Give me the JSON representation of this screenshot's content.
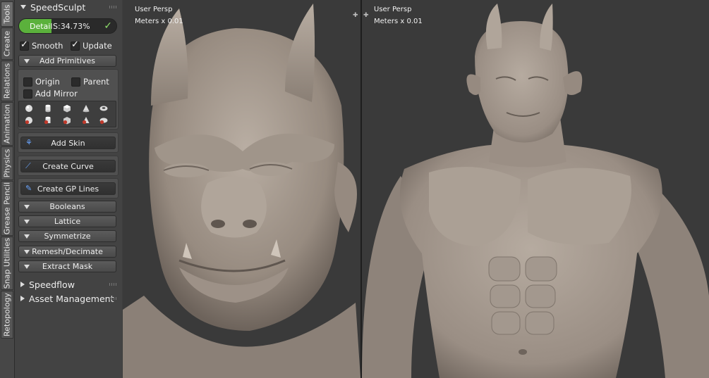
{
  "tabs": [
    "Tools",
    "Create",
    "Relations",
    "Animation",
    "Physics",
    "Grease Pencil",
    "Snap Utilities",
    "Retopology"
  ],
  "panel": {
    "title": "SpeedSculpt",
    "detail": {
      "label": "Detail",
      "value": "S:34.73%",
      "fill_fraction": 0.33
    },
    "smooth": {
      "label": "Smooth",
      "checked": true
    },
    "update": {
      "label": "Update",
      "checked": true
    },
    "add_primitives": "Add Primitives",
    "origin": "Origin",
    "parent": "Parent",
    "add_mirror": "Add Mirror",
    "primitive_icons": [
      "sphere-icon",
      "cylinder-icon",
      "cube-icon",
      "cone-icon",
      "torus-icon",
      "sphere-icon",
      "cylinder-icon",
      "cube-icon",
      "cone-icon",
      "torus-icon"
    ],
    "add_skin": "Add Skin",
    "create_curve": "Create Curve",
    "create_gp_lines": "Create GP Lines",
    "booleans": "Booleans",
    "lattice": "Lattice",
    "symmetrize": "Symmetrize",
    "remesh": "Remesh/Decimate",
    "extract_mask": "Extract Mask",
    "speedflow": "Speedflow",
    "asset_management": "Asset Management"
  },
  "viewports": {
    "left": {
      "view": "User Persp",
      "units": "Meters x 0.01"
    },
    "right": {
      "view": "User Persp",
      "units": "Meters x 0.01"
    }
  },
  "colors": {
    "accent": "#5bb13c",
    "panel": "#434343",
    "viewport_bg": "#3a3a3a",
    "clay": "#a89d92"
  }
}
